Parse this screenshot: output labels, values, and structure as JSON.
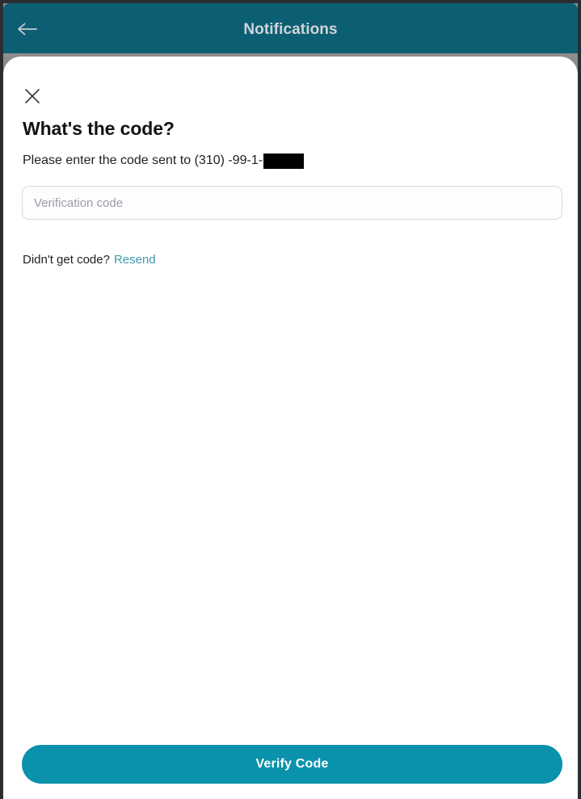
{
  "appbar": {
    "back_icon": "arrow-left-icon",
    "title": "Notifications",
    "background_color": "#0c5f73",
    "title_color": "#cfd4d6"
  },
  "sheet": {
    "close_icon": "close-x-icon",
    "headline": "What's the code?",
    "subline_prefix": "Please enter the code sent to (310) -99-1-",
    "redaction": "",
    "input": {
      "placeholder": "Verification code",
      "value": ""
    },
    "resend": {
      "question": "Didn't get code?",
      "link_label": "Resend",
      "link_color": "#3f9aab"
    },
    "primary_button": {
      "label": "Verify Code",
      "background_color": "#0a91ab",
      "text_color": "#ffffff"
    }
  }
}
